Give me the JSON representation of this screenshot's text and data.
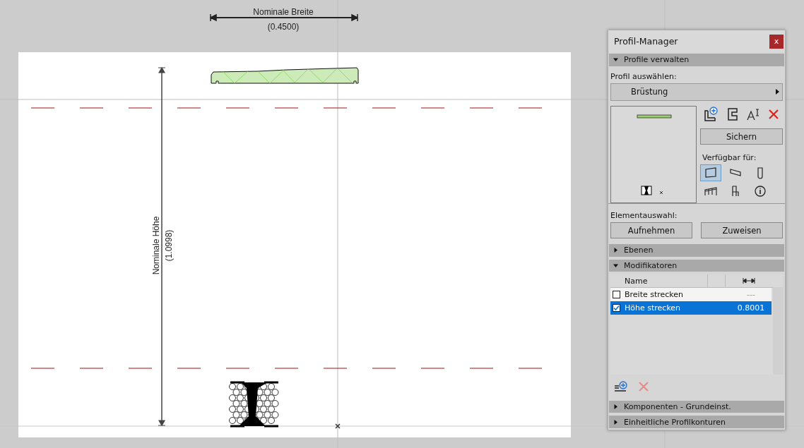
{
  "canvas": {
    "width_dimension": {
      "label": "Nominale Breite",
      "value": "(0.4500)"
    },
    "height_dimension": {
      "label": "Nominale Höhe",
      "value": "(1.0998)"
    }
  },
  "panel": {
    "title": "Profil-Manager",
    "close_label": "x",
    "manage_section": {
      "title": "Profile verwalten",
      "expanded": true
    },
    "profile_select": {
      "label": "Profil auswählen:",
      "value": "Brüstung"
    },
    "save_button": "Sichern",
    "available_for": {
      "label": "Verfügbar für:",
      "items": [
        {
          "kind": "wall",
          "selected": true
        },
        {
          "kind": "beam",
          "selected": false
        },
        {
          "kind": "column",
          "selected": false
        },
        {
          "kind": "railing",
          "selected": false
        },
        {
          "kind": "chair",
          "selected": false
        },
        {
          "kind": "info",
          "selected": false
        }
      ]
    },
    "element_selection": {
      "label": "Elementauswahl:",
      "buttons": [
        "Aufnehmen",
        "Zuweisen"
      ]
    },
    "layers_section": {
      "title": "Ebenen",
      "expanded": false
    },
    "modifiers_section": {
      "title": "Modifikatoren",
      "expanded": true
    },
    "modifiers_table": {
      "columns": [
        "Name"
      ],
      "rows": [
        {
          "name": "Breite strecken",
          "value": "---",
          "checked": false,
          "selected": false
        },
        {
          "name": "Höhe strecken",
          "value": "0.8001",
          "checked": true,
          "selected": true
        }
      ]
    },
    "components_section": {
      "title": "Komponenten - Grundeinst.",
      "expanded": false
    },
    "contours_section": {
      "title": "Einheitliche Profilkonturen",
      "expanded": false
    }
  }
}
